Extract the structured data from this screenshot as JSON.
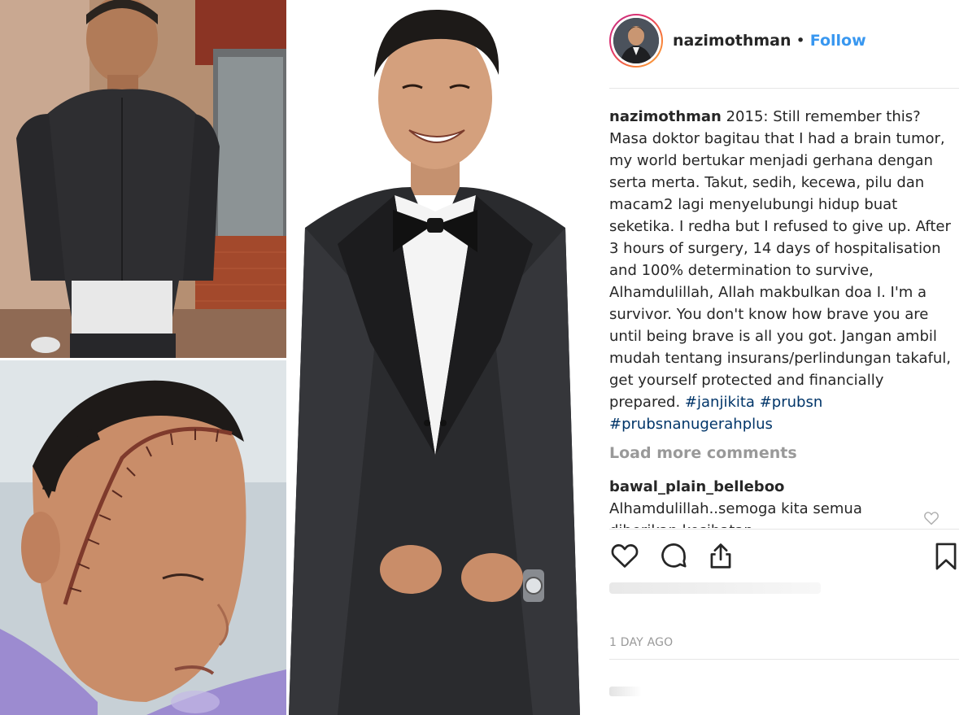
{
  "post": {
    "username": "nazimothman",
    "separator": "•",
    "follow_label": "Follow",
    "caption_user": "nazimothman",
    "caption_text": "2015: Still remember this? Masa doktor bagitau that I had a brain tumor, my world bertukar menjadi gerhana dengan serta merta. Takut, sedih, kecewa, pilu dan macam2 lagi menyelubungi hidup buat seketika. I redha but I refused to give up. After 3 hours of surgery, 14 days of hospitalisation and 100% determination to survive, Alhamdulillah, Allah makbulkan doa I. I'm a survivor. You don't know how brave you are until being brave is all you got. Jangan ambil mudah tentang insurans/perlindungan takaful, get yourself protected and financially prepared.",
    "hashtags": [
      "#janjikita",
      "#prubsn",
      "#prubsnanugerahplus"
    ],
    "load_more": "Load more comments",
    "comment": {
      "user": "bawal_plain_belleboo",
      "text": "Alhamdulillah..semoga kita semua diberikan kesihatan"
    },
    "timestamp": "1 DAY AGO"
  },
  "icons": {
    "like": "heart-icon",
    "comment": "comment-bubble-icon",
    "share": "share-upload-icon",
    "save": "bookmark-icon",
    "comment_like": "small-heart-icon"
  },
  "colors": {
    "follow": "#3897f0",
    "hashtag": "#003569",
    "muted": "#999999",
    "text": "#262626",
    "avatar_ring_start": "#c13584",
    "avatar_ring_end": "#fcaf45"
  }
}
